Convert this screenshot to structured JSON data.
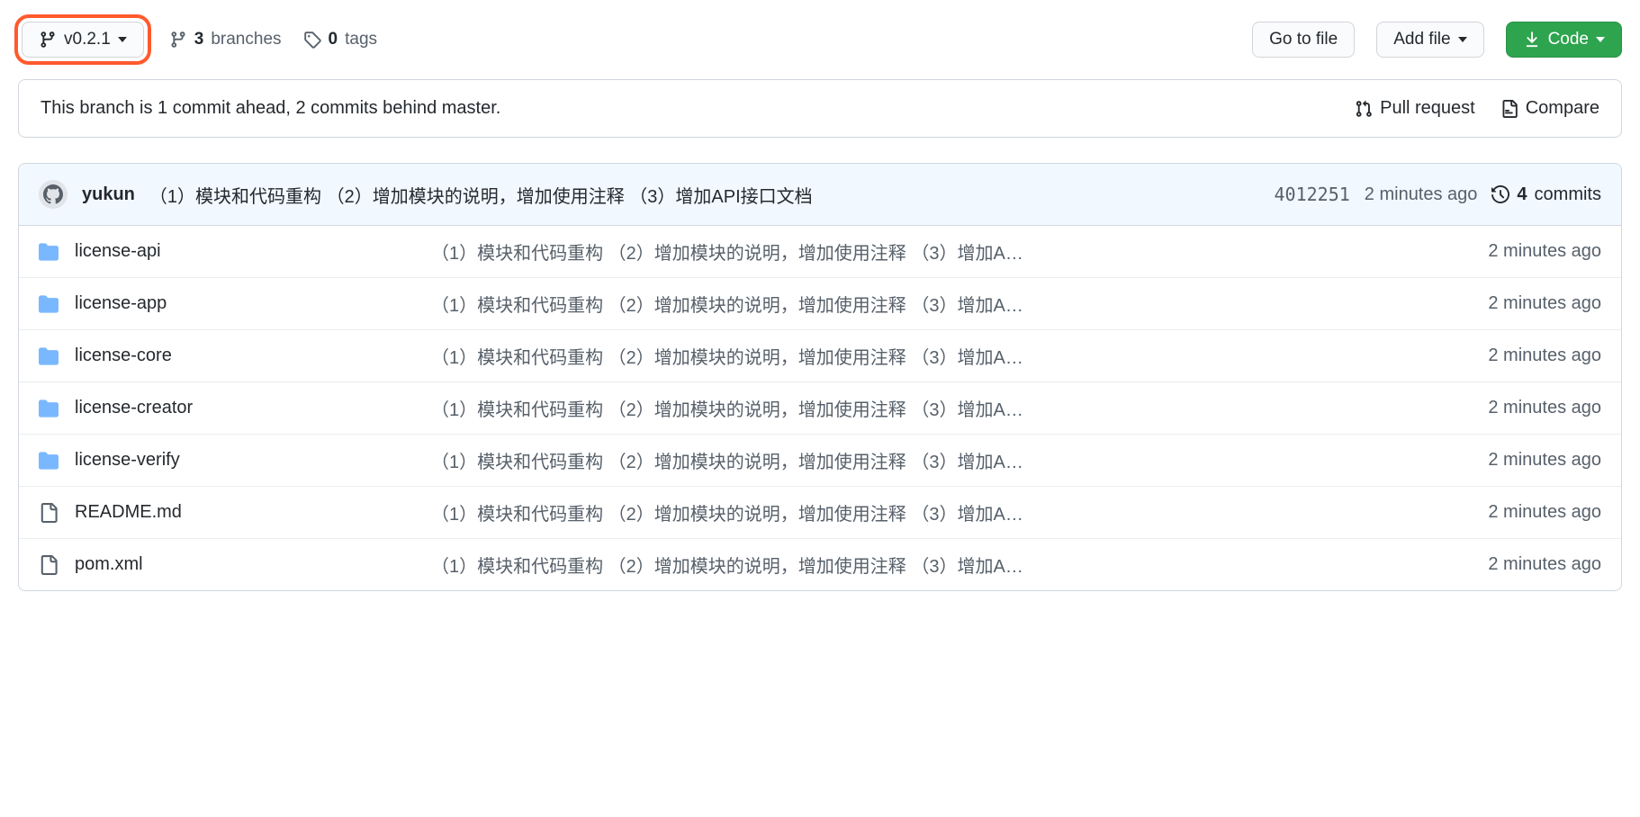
{
  "toolbar": {
    "branch_label": "v0.2.1",
    "branches": {
      "count": "3",
      "label": "branches"
    },
    "tags": {
      "count": "0",
      "label": "tags"
    },
    "go_to_file": "Go to file",
    "add_file": "Add file",
    "code": "Code"
  },
  "branch_status": {
    "text": "This branch is 1 commit ahead, 2 commits behind master.",
    "pull_request": "Pull request",
    "compare": "Compare"
  },
  "latest_commit": {
    "author": "yukun",
    "message": "（1）模块和代码重构 （2）增加模块的说明，增加使用注释 （3）增加API接口文档",
    "sha": "4012251",
    "time": "2 minutes ago",
    "commits_count": "4",
    "commits_label": "commits"
  },
  "files": [
    {
      "type": "dir",
      "name": "license-api",
      "msg": "（1）模块和代码重构 （2）增加模块的说明，增加使用注释 （3）增加A…",
      "time": "2 minutes ago"
    },
    {
      "type": "dir",
      "name": "license-app",
      "msg": "（1）模块和代码重构 （2）增加模块的说明，增加使用注释 （3）增加A…",
      "time": "2 minutes ago"
    },
    {
      "type": "dir",
      "name": "license-core",
      "msg": "（1）模块和代码重构 （2）增加模块的说明，增加使用注释 （3）增加A…",
      "time": "2 minutes ago"
    },
    {
      "type": "dir",
      "name": "license-creator",
      "msg": "（1）模块和代码重构 （2）增加模块的说明，增加使用注释 （3）增加A…",
      "time": "2 minutes ago"
    },
    {
      "type": "dir",
      "name": "license-verify",
      "msg": "（1）模块和代码重构 （2）增加模块的说明，增加使用注释 （3）增加A…",
      "time": "2 minutes ago"
    },
    {
      "type": "file",
      "name": "README.md",
      "msg": "（1）模块和代码重构 （2）增加模块的说明，增加使用注释 （3）增加A…",
      "time": "2 minutes ago"
    },
    {
      "type": "file",
      "name": "pom.xml",
      "msg": "（1）模块和代码重构 （2）增加模块的说明，增加使用注释 （3）增加A…",
      "time": "2 minutes ago"
    }
  ]
}
